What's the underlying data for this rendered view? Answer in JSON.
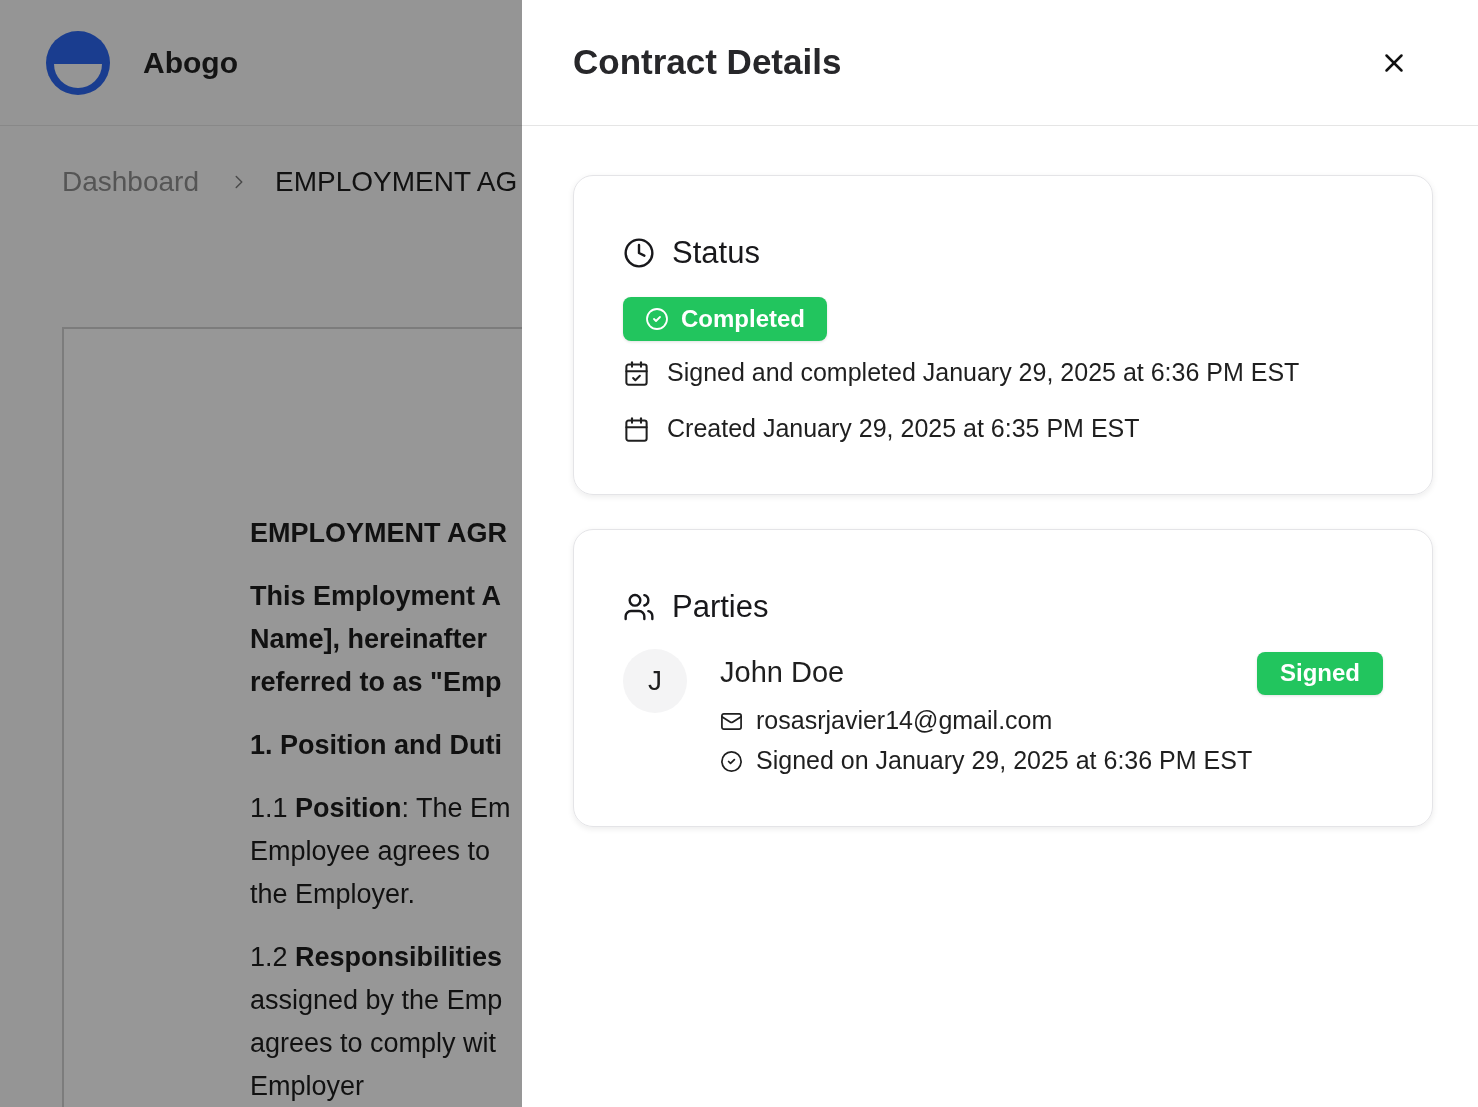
{
  "app": {
    "name": "Abogo"
  },
  "breadcrumb": [
    {
      "label": "Dashboard",
      "current": false
    },
    {
      "label": "EMPLOYMENT AG",
      "current": true
    }
  ],
  "document": {
    "blocks": [
      {
        "kind": "title",
        "lines": [
          "EMPLOYMENT AGR"
        ]
      },
      {
        "kind": "intro",
        "lines": [
          "This Employment A",
          "Name], hereinafter",
          "referred to as \"Emp"
        ]
      },
      {
        "kind": "heading",
        "lines": [
          "1. Position and Duti"
        ]
      },
      {
        "kind": "clause",
        "lines": [
          "1.1 **Position**: The Em",
          "Employee agrees to",
          "the Employer."
        ]
      },
      {
        "kind": "clause",
        "lines": [
          "1.2 **Responsibilities**",
          "assigned by the Emp",
          "agrees to comply wit",
          "Employer"
        ]
      }
    ]
  },
  "panel": {
    "title": "Contract Details"
  },
  "status_card": {
    "title": "Status",
    "badge": {
      "label": "Completed",
      "completed": true
    },
    "events": [
      {
        "kind": "signed",
        "text": "Signed and completed January 29, 2025 at 6:36 PM EST"
      },
      {
        "kind": "created",
        "text": "Created January 29, 2025 at 6:35 PM EST"
      }
    ]
  },
  "parties_card": {
    "title": "Parties",
    "items": [
      {
        "initial": "J",
        "name": "John Doe",
        "badge": "Signed",
        "signed": true,
        "email": "rosasrjavier14@gmail.com",
        "signed_on": "Signed on January 29, 2025 at 6:36 PM EST"
      }
    ]
  }
}
